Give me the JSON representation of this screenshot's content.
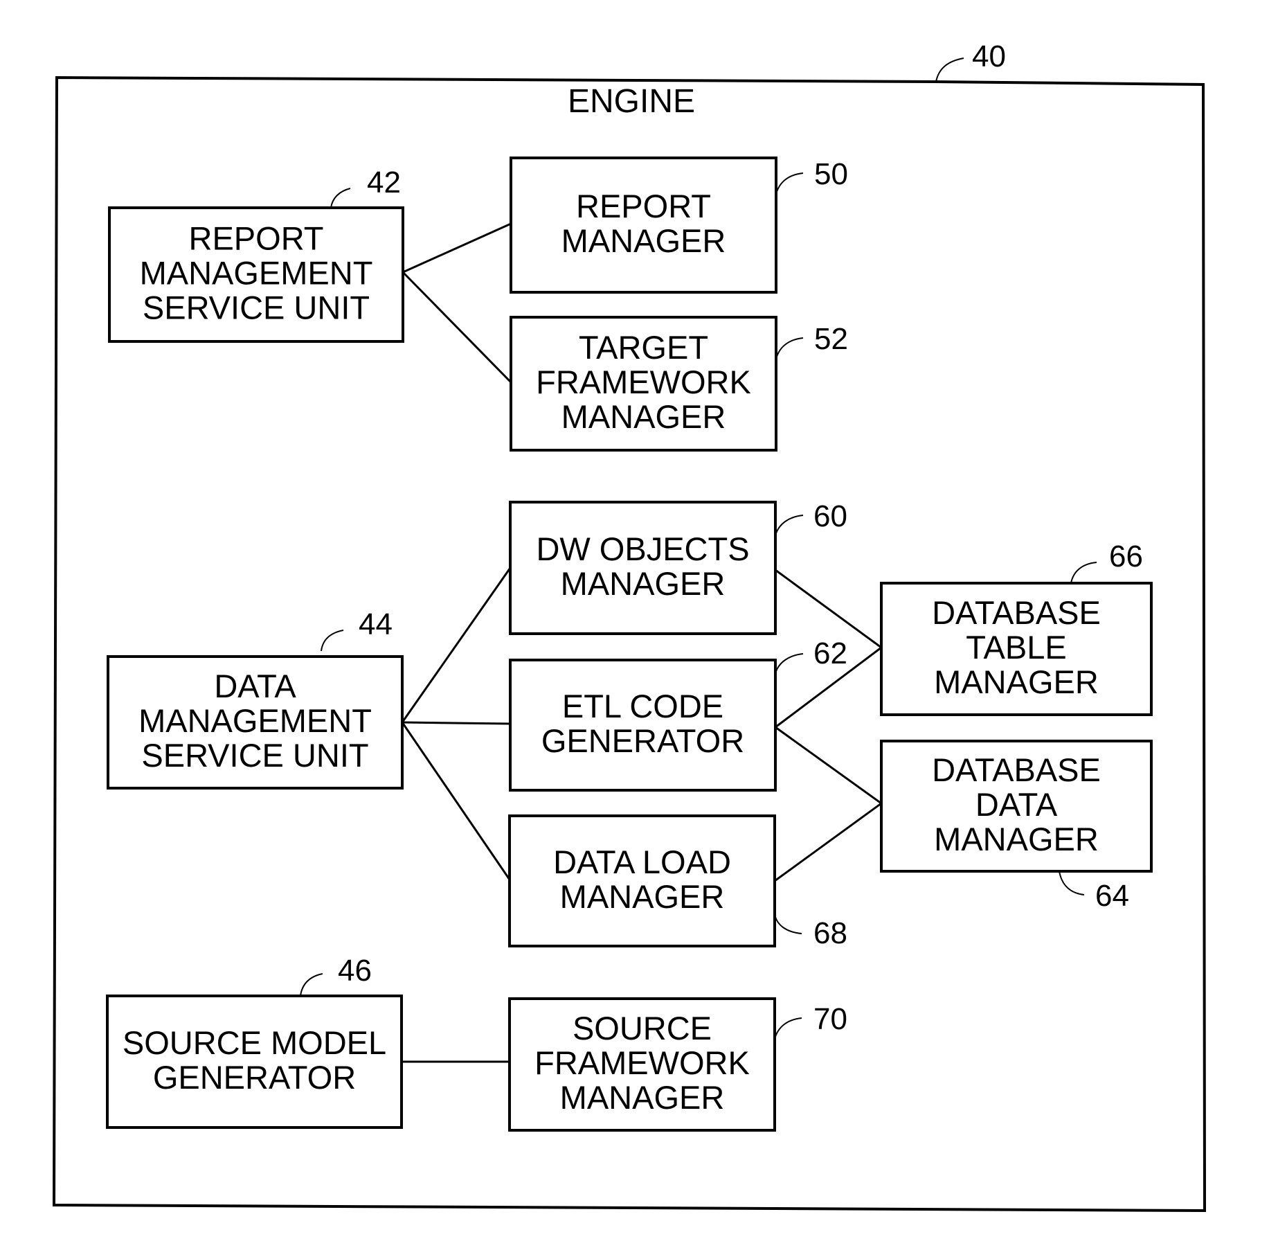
{
  "engine": {
    "title": "ENGINE",
    "ref": "40"
  },
  "nodes": [
    {
      "id": "42",
      "ref": "42",
      "lines": [
        "REPORT",
        "MANAGEMENT",
        "SERVICE UNIT"
      ]
    },
    {
      "id": "50",
      "ref": "50",
      "lines": [
        "REPORT",
        "MANAGER"
      ]
    },
    {
      "id": "52",
      "ref": "52",
      "lines": [
        "TARGET",
        "FRAMEWORK",
        "MANAGER"
      ]
    },
    {
      "id": "44",
      "ref": "44",
      "lines": [
        "DATA",
        "MANAGEMENT",
        "SERVICE UNIT"
      ]
    },
    {
      "id": "60",
      "ref": "60",
      "lines": [
        "DW OBJECTS",
        "MANAGER"
      ]
    },
    {
      "id": "62",
      "ref": "62",
      "lines": [
        "ETL CODE",
        "GENERATOR"
      ]
    },
    {
      "id": "68",
      "ref": "68",
      "lines": [
        "DATA LOAD",
        "MANAGER"
      ]
    },
    {
      "id": "66",
      "ref": "66",
      "lines": [
        "DATABASE",
        "TABLE",
        "MANAGER"
      ]
    },
    {
      "id": "64",
      "ref": "64",
      "lines": [
        "DATABASE",
        "DATA",
        "MANAGER"
      ]
    },
    {
      "id": "46",
      "ref": "46",
      "lines": [
        "SOURCE MODEL",
        "GENERATOR"
      ]
    },
    {
      "id": "70",
      "ref": "70",
      "lines": [
        "SOURCE",
        "FRAMEWORK",
        "MANAGER"
      ]
    }
  ],
  "edges": [
    {
      "from": "42",
      "to": "50"
    },
    {
      "from": "42",
      "to": "52"
    },
    {
      "from": "44",
      "to": "60"
    },
    {
      "from": "44",
      "to": "62"
    },
    {
      "from": "44",
      "to": "68"
    },
    {
      "from": "60",
      "to": "66"
    },
    {
      "from": "62",
      "to": "66"
    },
    {
      "from": "62",
      "to": "64"
    },
    {
      "from": "68",
      "to": "64"
    },
    {
      "from": "46",
      "to": "70"
    }
  ]
}
